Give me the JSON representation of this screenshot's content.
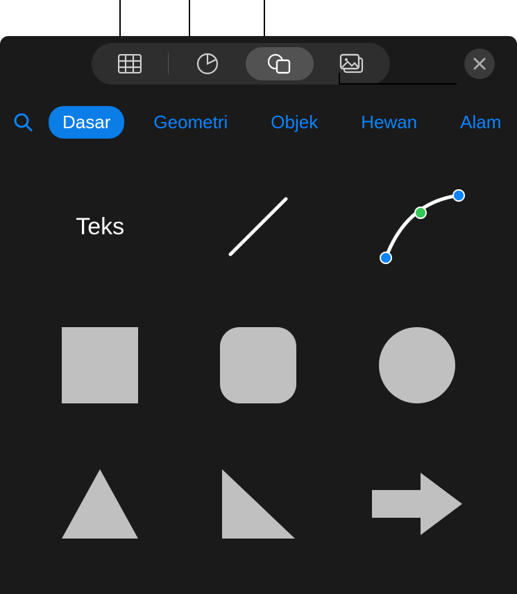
{
  "toolbar": {
    "items": [
      {
        "name": "table-icon",
        "active": false
      },
      {
        "name": "chart-icon",
        "active": false
      },
      {
        "name": "shape-icon",
        "active": true
      },
      {
        "name": "media-icon",
        "active": false
      }
    ],
    "close_label": "Close"
  },
  "categories": {
    "items": [
      {
        "label": "Dasar",
        "active": true
      },
      {
        "label": "Geometri",
        "active": false
      },
      {
        "label": "Objek",
        "active": false
      },
      {
        "label": "Hewan",
        "active": false
      },
      {
        "label": "Alam",
        "active": false
      }
    ]
  },
  "shapes": {
    "text_label": "Teks",
    "items": [
      {
        "name": "text-shape"
      },
      {
        "name": "line-shape"
      },
      {
        "name": "curve-bezier-shape"
      },
      {
        "name": "square-shape"
      },
      {
        "name": "rounded-square-shape"
      },
      {
        "name": "circle-shape"
      },
      {
        "name": "triangle-shape"
      },
      {
        "name": "right-triangle-shape"
      },
      {
        "name": "arrow-right-shape"
      }
    ]
  },
  "colors": {
    "accent": "#0a84ff",
    "shape_fill": "#c0c0c0"
  }
}
